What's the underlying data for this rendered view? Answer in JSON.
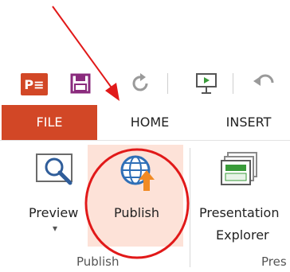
{
  "quick_access": {
    "app_logo_text": "P≡"
  },
  "tabs": [
    {
      "label": "FILE"
    },
    {
      "label": "HOME"
    },
    {
      "label": "INSERT"
    }
  ],
  "ribbon": {
    "preview_label": "Preview",
    "preview_dropdown": "▾",
    "publish_label": "Publish",
    "presentation_explorer_line1": "Presentation",
    "presentation_explorer_line2": "Explorer",
    "group_publish": "Publish",
    "group_present_partial": "Pres"
  },
  "colors": {
    "file_tab": "#d24726",
    "highlight": "#fde2d8",
    "annotation": "#e11919"
  }
}
